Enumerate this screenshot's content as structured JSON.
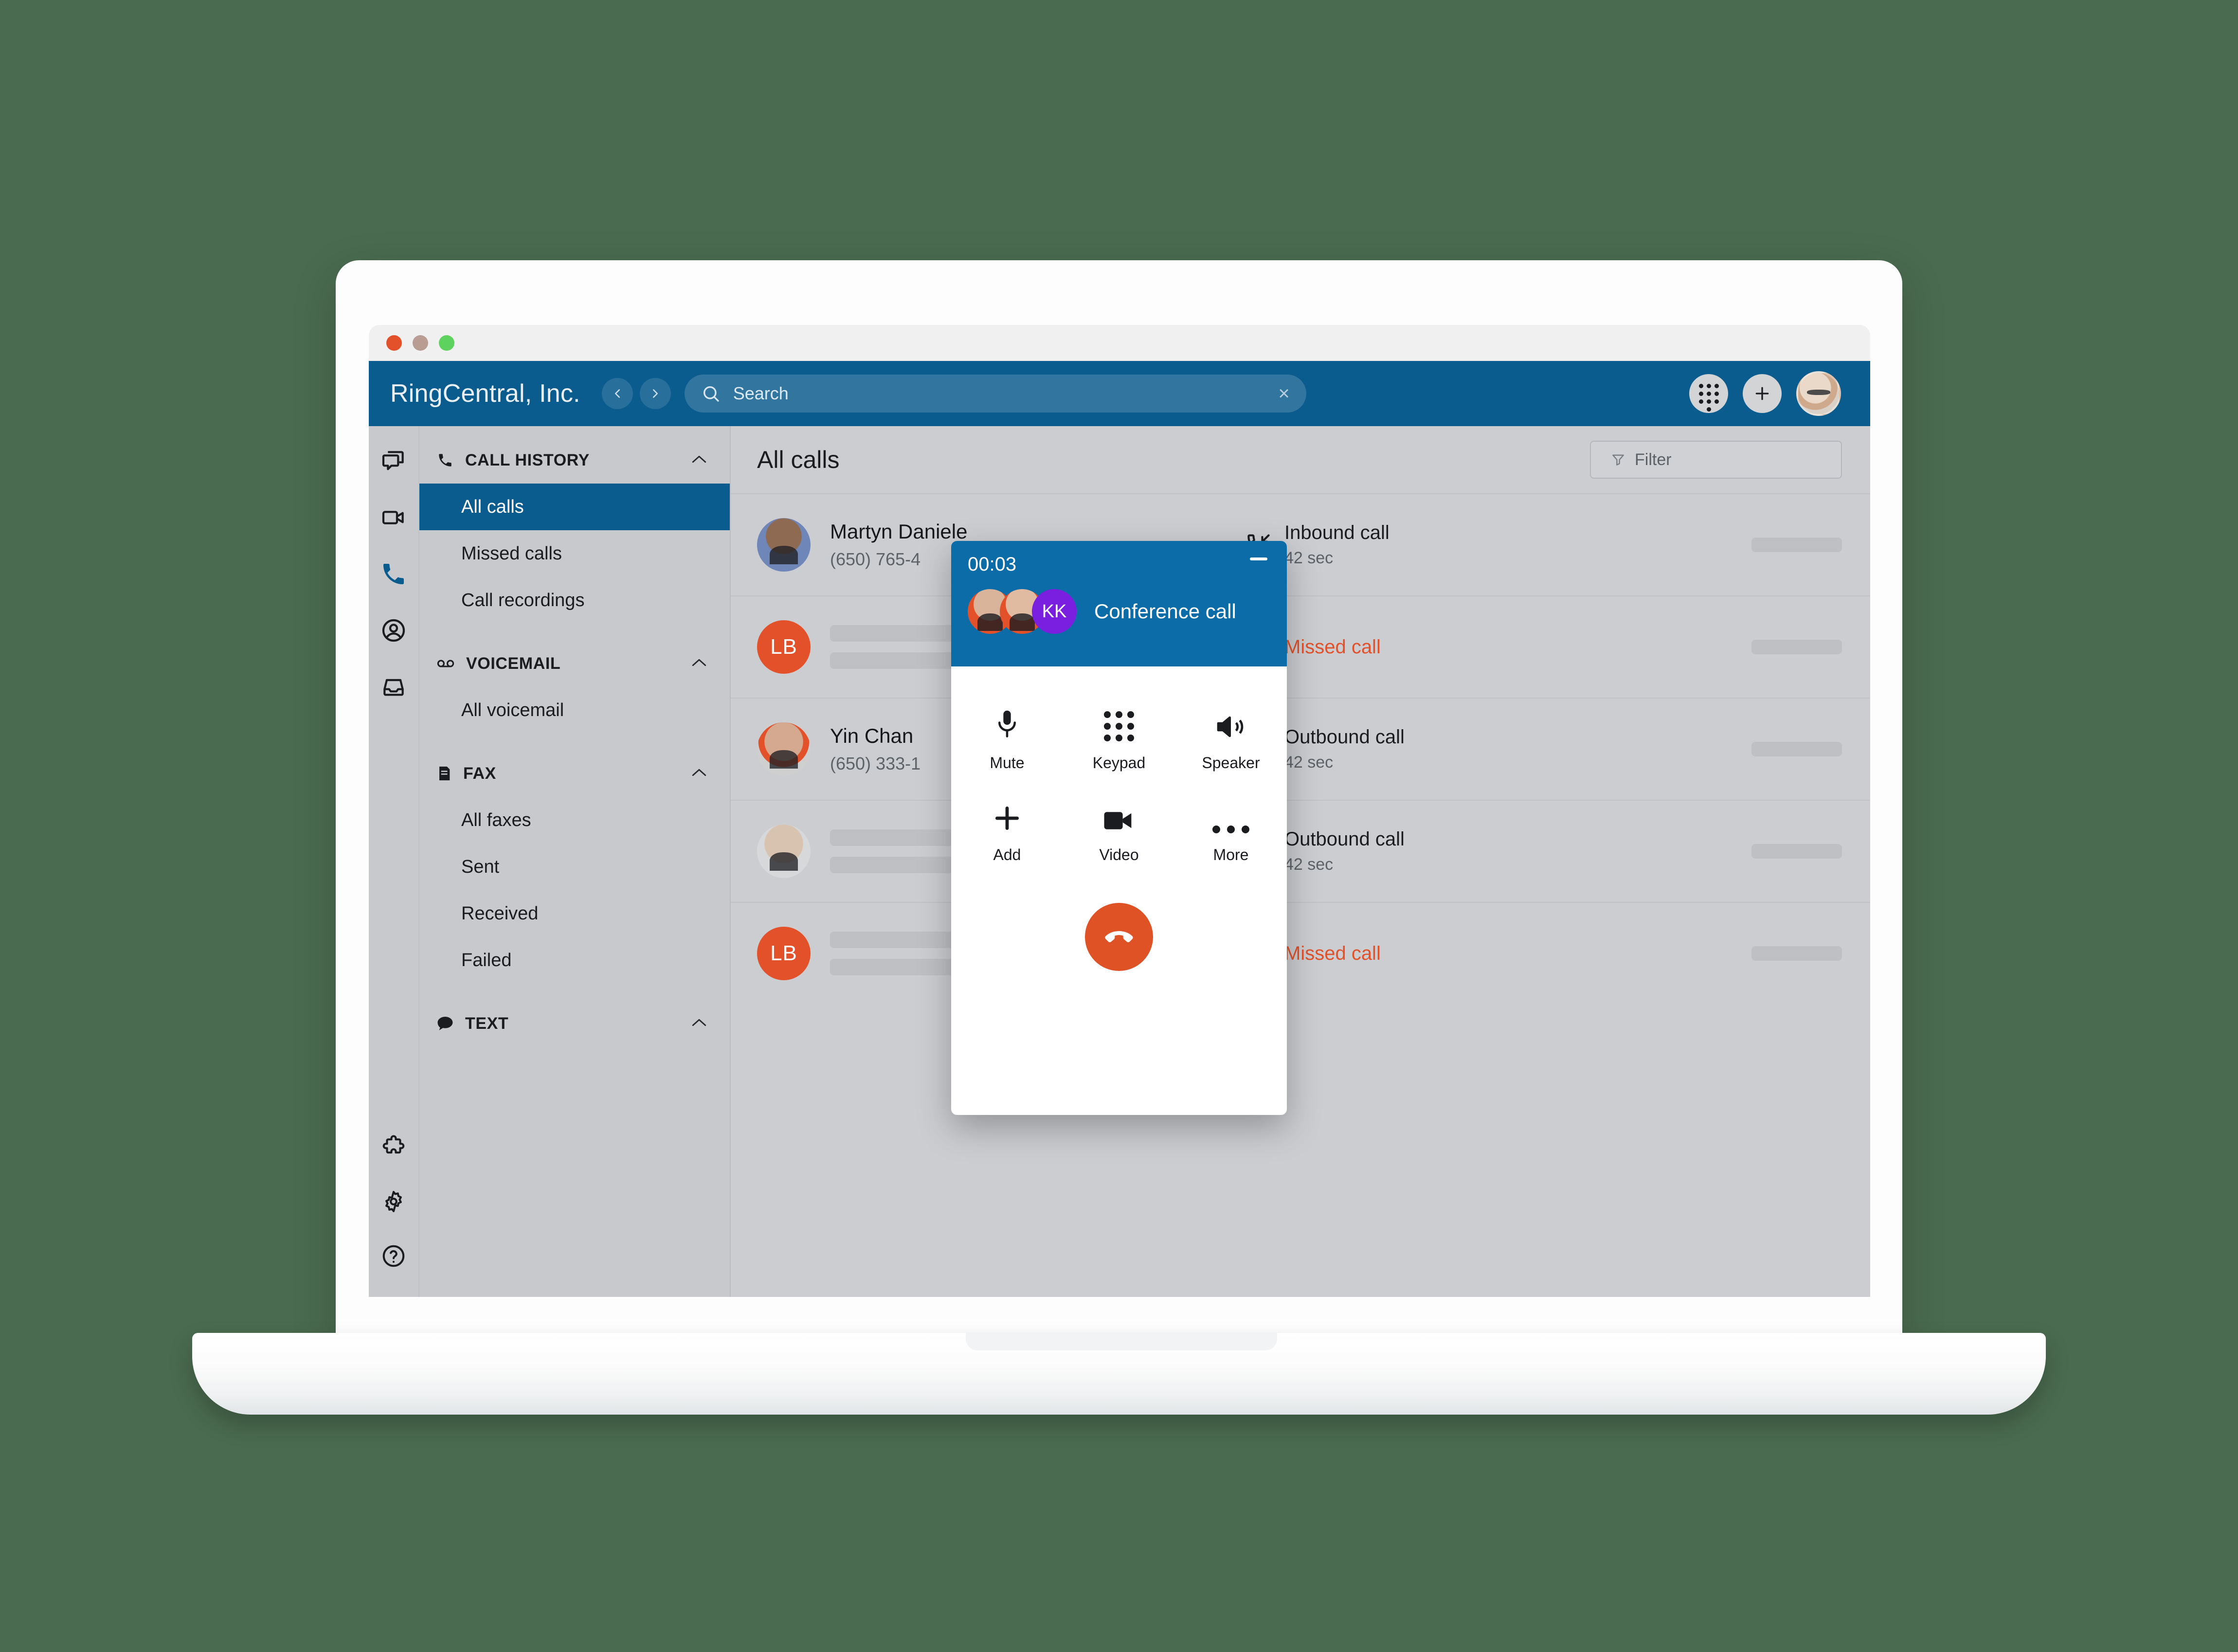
{
  "window": {
    "traffic_lights": [
      "close",
      "minimize",
      "zoom"
    ]
  },
  "topbar": {
    "brand_title": "RingCentral, Inc.",
    "back_icon": "chevron-left-icon",
    "forward_icon": "chevron-right-icon",
    "search_icon": "search-icon",
    "search_placeholder": "Search",
    "search_value": "",
    "clear_label": "×",
    "dialpad_icon": "dialpad-icon",
    "add_icon": "plus-icon",
    "avatar_icon": "user-avatar"
  },
  "icon_rail": {
    "top_items": [
      {
        "name": "messages-icon",
        "label": "Messages"
      },
      {
        "name": "video-icon",
        "label": "Video"
      },
      {
        "name": "phone-icon",
        "label": "Phone",
        "active": true
      },
      {
        "name": "contacts-icon",
        "label": "Contacts"
      },
      {
        "name": "inbox-icon",
        "label": "Inbox"
      }
    ],
    "bottom_items": [
      {
        "name": "puzzle-icon",
        "label": "Apps"
      },
      {
        "name": "gear-icon",
        "label": "Settings"
      },
      {
        "name": "help-icon",
        "label": "Help"
      }
    ]
  },
  "nav": {
    "sections": [
      {
        "id": "call-history",
        "icon": "phone-icon",
        "label": "CALL HISTORY",
        "chevron": "⌃",
        "items": [
          {
            "label": "All calls",
            "active": true
          },
          {
            "label": "Missed calls",
            "active": false
          },
          {
            "label": "Call recordings",
            "active": false
          }
        ]
      },
      {
        "id": "voicemail",
        "icon": "voicemail-icon",
        "label": "VOICEMAIL",
        "chevron": "⌃",
        "items": [
          {
            "label": "All voicemail",
            "active": false
          }
        ]
      },
      {
        "id": "fax",
        "icon": "fax-icon",
        "label": "FAX",
        "chevron": "⌃",
        "items": [
          {
            "label": "All faxes",
            "active": false
          },
          {
            "label": "Sent",
            "active": false
          },
          {
            "label": "Received",
            "active": false
          },
          {
            "label": "Failed",
            "active": false
          }
        ]
      },
      {
        "id": "text",
        "icon": "chat-bubble-icon",
        "label": "TEXT",
        "chevron": "⌃",
        "items": []
      }
    ]
  },
  "main": {
    "page_title": "All calls",
    "filter_icon": "funnel-icon",
    "filter_label": "Filter",
    "rows": [
      {
        "avatar_type": "photo",
        "avatar_class": "av-m",
        "initials": "",
        "name": "Martyn Daniele",
        "phone": "(650) 765-4",
        "redacted": false,
        "call_icon": "inbound-call-icon",
        "call_type": "Inbound call",
        "call_type_state": "normal",
        "duration": "42 sec"
      },
      {
        "avatar_type": "initials",
        "avatar_class": "",
        "initials": "LB",
        "name": "",
        "phone": "",
        "redacted": true,
        "call_icon": "missed-call-icon",
        "call_type": "Missed call",
        "call_type_state": "missed",
        "duration": ""
      },
      {
        "avatar_type": "photo",
        "avatar_class": "av-y",
        "initials": "",
        "name": "Yin Chan",
        "phone": "(650) 333-1",
        "redacted": false,
        "call_icon": "outbound-call-icon",
        "call_type": "Outbound call",
        "call_type_state": "normal",
        "duration": "42 sec"
      },
      {
        "avatar_type": "photo",
        "avatar_class": "av-g",
        "initials": "",
        "name": "",
        "phone": "",
        "redacted": true,
        "call_icon": "outbound-call-icon",
        "call_type": "Outbound call",
        "call_type_state": "normal",
        "duration": "42 sec"
      },
      {
        "avatar_type": "initials",
        "avatar_class": "",
        "initials": "LB",
        "name": "",
        "phone": "",
        "redacted": true,
        "call_icon": "missed-call-icon",
        "call_type": "Missed call",
        "call_type_state": "missed",
        "duration": ""
      }
    ]
  },
  "call_popup": {
    "timer": "00:03",
    "minimize_icon": "minimize-icon",
    "party_label": "Conference call",
    "participants": [
      {
        "type": "photo",
        "initials": ""
      },
      {
        "type": "photo",
        "initials": ""
      },
      {
        "type": "initials",
        "initials": "KK"
      }
    ],
    "controls": [
      {
        "icon": "microphone-icon",
        "label": "Mute"
      },
      {
        "icon": "dialpad-icon",
        "label": "Keypad"
      },
      {
        "icon": "speaker-icon",
        "label": "Speaker"
      },
      {
        "icon": "plus-icon",
        "label": "Add"
      },
      {
        "icon": "video-camera-icon",
        "label": "Video"
      },
      {
        "icon": "more-horizontal-icon",
        "label": "More"
      }
    ],
    "end_call_icon": "end-call-icon"
  },
  "colors": {
    "brand_blue": "#0b5c8e",
    "popup_blue": "#0b6ca8",
    "accent_orange": "#e2512a",
    "end_call_red": "#de5225",
    "kk_purple": "#7a1fe0",
    "panel_grey": "#c7c9cc",
    "page_bg": "#4a6b4f"
  }
}
